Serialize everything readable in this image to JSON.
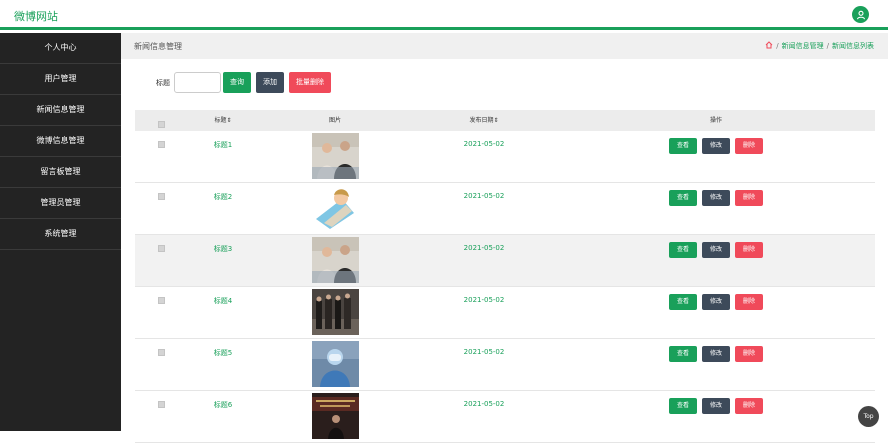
{
  "header": {
    "brand": "微博网站",
    "avatar_icon": "user-icon"
  },
  "sidebar": {
    "items": [
      {
        "label": "个人中心"
      },
      {
        "label": "用户管理"
      },
      {
        "label": "新闻信息管理"
      },
      {
        "label": "微博信息管理"
      },
      {
        "label": "留言板管理"
      },
      {
        "label": "管理员管理"
      },
      {
        "label": "系统管理"
      }
    ]
  },
  "page": {
    "title": "新闻信息管理",
    "breadcrumb": {
      "home_icon": "home-icon",
      "items": [
        "新闻信息管理",
        "新闻信息列表"
      ],
      "separator": "/"
    }
  },
  "search": {
    "label": "标题",
    "value": "",
    "buttons": {
      "query": "查询",
      "add": "添加",
      "batch_delete": "批量删除"
    }
  },
  "table": {
    "headers": {
      "title": "标题⇕",
      "image": "图片",
      "date": "发布日期⇕",
      "actions": "操作"
    },
    "row_actions": {
      "view": "查看",
      "edit": "修改",
      "delete": "删除"
    },
    "rows": [
      {
        "title": "标题1",
        "image": "photo-two-people",
        "date": "2021-05-02"
      },
      {
        "title": "标题2",
        "image": "illustration-person-lying",
        "date": "2021-05-02"
      },
      {
        "title": "标题3",
        "image": "photo-two-people",
        "date": "2021-05-02"
      },
      {
        "title": "标题4",
        "image": "photo-group-standing",
        "date": "2021-05-02"
      },
      {
        "title": "标题5",
        "image": "photo-protective-suit",
        "date": "2021-05-02"
      },
      {
        "title": "标题6",
        "image": "photo-stage-banner",
        "date": "2021-05-02"
      }
    ]
  },
  "back_to_top": "Top",
  "colors": {
    "accent": "#19a05a",
    "dark": "#3d4a5a",
    "danger": "#f04a5a",
    "sidebar": "#232323"
  }
}
